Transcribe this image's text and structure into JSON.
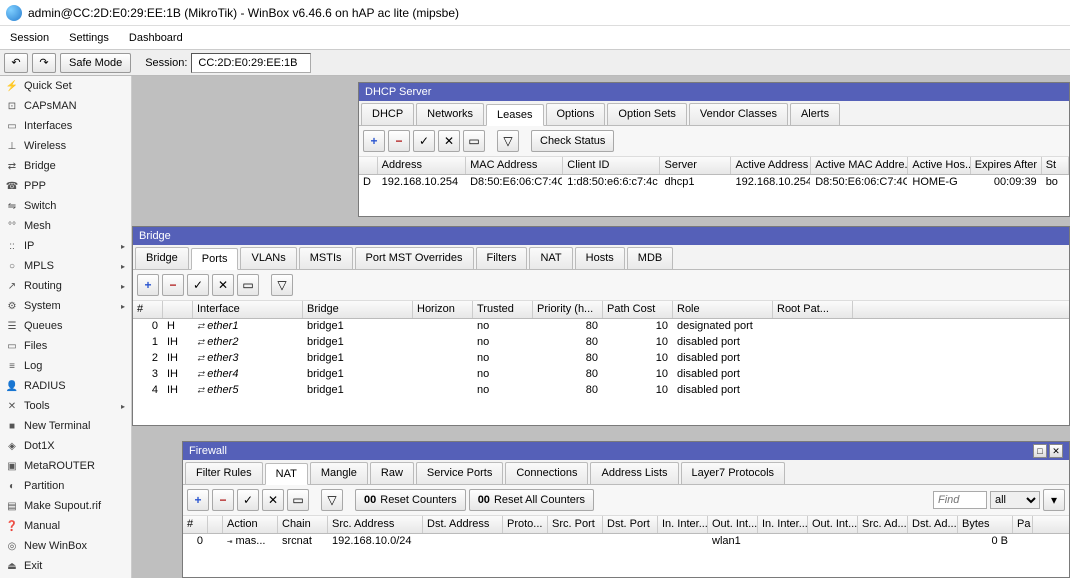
{
  "window": {
    "title": "admin@CC:2D:E0:29:EE:1B (MikroTik) - WinBox v6.46.6 on hAP ac lite (mipsbe)"
  },
  "menu": {
    "session": "Session",
    "settings": "Settings",
    "dashboard": "Dashboard"
  },
  "toolbar": {
    "undo": "↶",
    "redo": "↷",
    "safe_mode": "Safe Mode",
    "session_label": "Session:",
    "session_value": "CC:2D:E0:29:EE:1B"
  },
  "sidebar": [
    {
      "icon": "⚡",
      "label": "Quick Set",
      "sub": false
    },
    {
      "icon": "⊡",
      "label": "CAPsMAN",
      "sub": false
    },
    {
      "icon": "▭",
      "label": "Interfaces",
      "sub": false
    },
    {
      "icon": "⊥",
      "label": "Wireless",
      "sub": false
    },
    {
      "icon": "⇄",
      "label": "Bridge",
      "sub": false
    },
    {
      "icon": "☎",
      "label": "PPP",
      "sub": false
    },
    {
      "icon": "⇋",
      "label": "Switch",
      "sub": false
    },
    {
      "icon": "°°",
      "label": "Mesh",
      "sub": false
    },
    {
      "icon": "::",
      "label": "IP",
      "sub": true
    },
    {
      "icon": "○",
      "label": "MPLS",
      "sub": true
    },
    {
      "icon": "↗",
      "label": "Routing",
      "sub": true
    },
    {
      "icon": "⚙",
      "label": "System",
      "sub": true
    },
    {
      "icon": "☰",
      "label": "Queues",
      "sub": false
    },
    {
      "icon": "▭",
      "label": "Files",
      "sub": false
    },
    {
      "icon": "≡",
      "label": "Log",
      "sub": false
    },
    {
      "icon": "👤",
      "label": "RADIUS",
      "sub": false
    },
    {
      "icon": "✕",
      "label": "Tools",
      "sub": true
    },
    {
      "icon": "■",
      "label": "New Terminal",
      "sub": false
    },
    {
      "icon": "◈",
      "label": "Dot1X",
      "sub": false
    },
    {
      "icon": "▣",
      "label": "MetaROUTER",
      "sub": false
    },
    {
      "icon": "◐",
      "label": "Partition",
      "sub": false
    },
    {
      "icon": "▤",
      "label": "Make Supout.rif",
      "sub": false
    },
    {
      "icon": "❓",
      "label": "Manual",
      "sub": false
    },
    {
      "icon": "◎",
      "label": "New WinBox",
      "sub": false
    },
    {
      "icon": "⏏",
      "label": "Exit",
      "sub": false
    }
  ],
  "dhcp": {
    "title": "DHCP Server",
    "tabs": [
      "DHCP",
      "Networks",
      "Leases",
      "Options",
      "Option Sets",
      "Vendor Classes",
      "Alerts"
    ],
    "active_tab": 2,
    "check_btn": "Check Status",
    "cols": [
      "",
      "Address",
      "MAC Address",
      "Client ID",
      "Server",
      "Active Address",
      "Active MAC Addre...",
      "Active Hos...",
      "Expires After",
      "St"
    ],
    "widths": [
      20,
      100,
      110,
      110,
      80,
      90,
      110,
      70,
      80,
      30
    ],
    "rows": [
      [
        "D",
        "192.168.10.254",
        "D8:50:E6:06:C7:4C",
        "1:d8:50:e6:6:c7:4c",
        "dhcp1",
        "192.168.10.254",
        "D8:50:E6:06:C7:4C",
        "HOME-G",
        "00:09:39",
        "bo"
      ]
    ]
  },
  "bridge": {
    "title": "Bridge",
    "tabs": [
      "Bridge",
      "Ports",
      "VLANs",
      "MSTIs",
      "Port MST Overrides",
      "Filters",
      "NAT",
      "Hosts",
      "MDB"
    ],
    "active_tab": 1,
    "cols": [
      "#",
      "",
      "Interface",
      "Bridge",
      "Horizon",
      "Trusted",
      "Priority (h...",
      "Path Cost",
      "Role",
      "Root Pat..."
    ],
    "widths": [
      30,
      30,
      110,
      110,
      60,
      60,
      70,
      70,
      100,
      80
    ],
    "rows": [
      [
        "0",
        "H",
        "ether1",
        "bridge1",
        "",
        "no",
        "80",
        "10",
        "designated port",
        ""
      ],
      [
        "1",
        "IH",
        "ether2",
        "bridge1",
        "",
        "no",
        "80",
        "10",
        "disabled port",
        ""
      ],
      [
        "2",
        "IH",
        "ether3",
        "bridge1",
        "",
        "no",
        "80",
        "10",
        "disabled port",
        ""
      ],
      [
        "3",
        "IH",
        "ether4",
        "bridge1",
        "",
        "no",
        "80",
        "10",
        "disabled port",
        ""
      ],
      [
        "4",
        "IH",
        "ether5",
        "bridge1",
        "",
        "no",
        "80",
        "10",
        "disabled port",
        ""
      ]
    ]
  },
  "firewall": {
    "title": "Firewall",
    "tabs": [
      "Filter Rules",
      "NAT",
      "Mangle",
      "Raw",
      "Service Ports",
      "Connections",
      "Address Lists",
      "Layer7 Protocols"
    ],
    "active_tab": 1,
    "reset1": "Reset Counters",
    "reset2": "Reset All Counters",
    "find_ph": "Find",
    "filter_all": "all",
    "cols": [
      "#",
      "",
      "Action",
      "Chain",
      "Src. Address",
      "Dst. Address",
      "Proto...",
      "Src. Port",
      "Dst. Port",
      "In. Inter...",
      "Out. Int...",
      "In. Inter...",
      "Out. Int...",
      "Src. Ad...",
      "Dst. Ad...",
      "Bytes",
      "Pa"
    ],
    "widths": [
      25,
      15,
      55,
      50,
      95,
      80,
      45,
      55,
      55,
      50,
      50,
      50,
      50,
      50,
      50,
      55,
      20
    ],
    "rows": [
      [
        "0",
        "",
        "mas...",
        "srcnat",
        "192.168.10.0/24",
        "",
        "",
        "",
        "",
        "",
        "wlan1",
        "",
        "",
        "",
        "",
        "0 B",
        ""
      ]
    ]
  }
}
